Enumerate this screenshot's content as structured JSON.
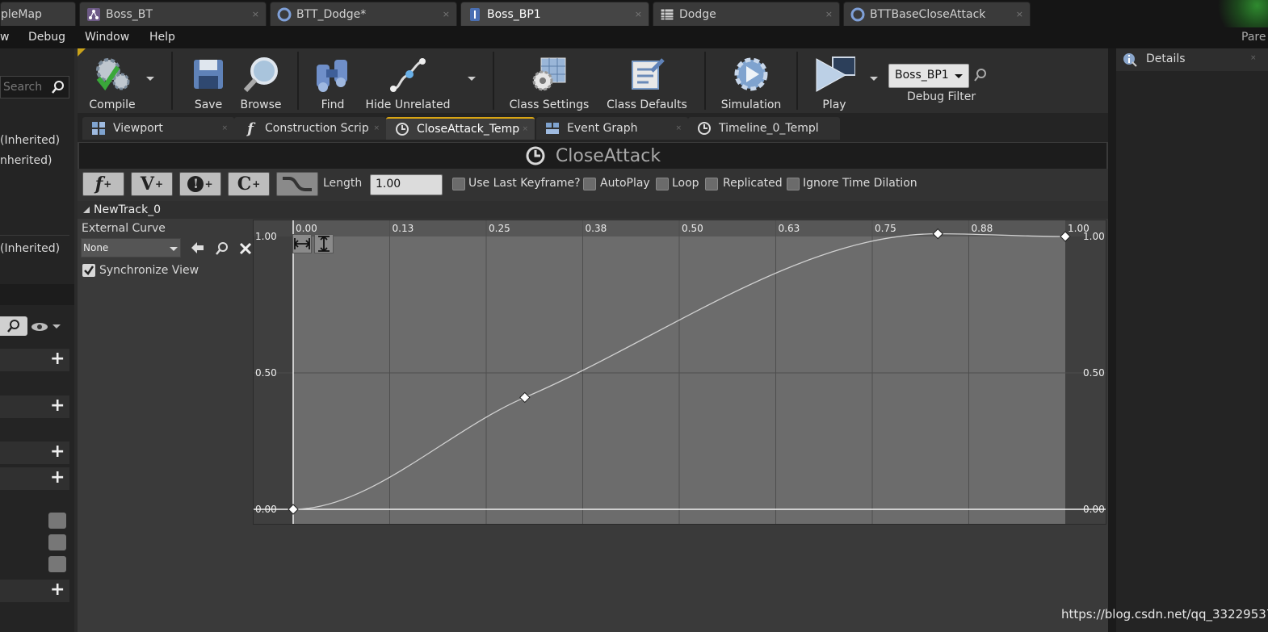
{
  "doc_tabs": [
    {
      "label": "pleMap",
      "icon": "map-icon",
      "active": false
    },
    {
      "label": "Boss_BT",
      "icon": "behavior-tree-icon",
      "active": false
    },
    {
      "label": "BTT_Dodge*",
      "icon": "blueprint-icon",
      "active": false
    },
    {
      "label": "Boss_BP1",
      "icon": "actor-blueprint-icon",
      "active": true
    },
    {
      "label": "Dodge",
      "icon": "datatable-icon",
      "active": false
    },
    {
      "label": "BTTBaseCloseAttack",
      "icon": "blueprint-icon",
      "active": false
    }
  ],
  "tab_close_glyph": "×",
  "top_right_label": "Pare",
  "menu": [
    "w",
    "Debug",
    "Window",
    "Help"
  ],
  "left_panel": {
    "search_placeholder": "Search",
    "inherited": [
      "(Inherited)",
      "nherited)",
      "(Inherited)"
    ]
  },
  "toolbar": {
    "compile": "Compile",
    "save": "Save",
    "browse": "Browse",
    "find": "Find",
    "hide_unrelated": "Hide Unrelated",
    "class_settings": "Class Settings",
    "class_defaults": "Class Defaults",
    "simulation": "Simulation",
    "play": "Play",
    "debug_filter_value": "Boss_BP1",
    "debug_filter_label": "Debug Filter"
  },
  "details_panel": {
    "title": "Details"
  },
  "editor_tabs": [
    {
      "label": "Viewport",
      "icon": "viewport-icon",
      "active": false
    },
    {
      "label": "Construction Scrip",
      "icon": "function-icon",
      "active": false
    },
    {
      "label": "CloseAttack_Temp",
      "icon": "timeline-icon",
      "active": true
    },
    {
      "label": "Event Graph",
      "icon": "event-graph-icon",
      "active": false
    },
    {
      "label": "Timeline_0_Templ",
      "icon": "timeline-icon",
      "active": false
    }
  ],
  "timeline": {
    "title": "CloseAttack",
    "track_buttons": [
      "f",
      "V",
      "!",
      "C"
    ],
    "length_label": "Length",
    "length_value": "1.00",
    "options": [
      {
        "label": "Use Last Keyframe?",
        "checked": false
      },
      {
        "label": "AutoPlay",
        "checked": false
      },
      {
        "label": "Loop",
        "checked": false
      },
      {
        "label": "Replicated",
        "checked": false
      },
      {
        "label": "Ignore Time Dilation",
        "checked": false
      }
    ],
    "track_name": "NewTrack_0",
    "external_curve_label": "External Curve",
    "external_curve_value": "None",
    "synchronize_view_label": "Synchronize View",
    "synchronize_view_checked": true
  },
  "chart_data": {
    "type": "line",
    "x_ticks": [
      "0.00",
      "0.13",
      "0.25",
      "0.38",
      "0.50",
      "0.63",
      "0.75",
      "0.88",
      "1.00"
    ],
    "y_ticks": [
      "1.00",
      "0.50",
      "0.00"
    ],
    "xlim": [
      0,
      1.0
    ],
    "ylim": [
      0,
      1.0
    ],
    "keys": [
      {
        "x": 0.0,
        "y": 0.0
      },
      {
        "x": 0.3,
        "y": 0.41
      },
      {
        "x": 0.835,
        "y": 1.01
      },
      {
        "x": 1.0,
        "y": 1.0
      }
    ]
  },
  "watermark": "https://blog.csdn.net/qq_33229537",
  "colors": {
    "active_tab_accent": "#d9a514",
    "curve": "#d0d0d0",
    "graph_bg": "#6c6c6c"
  }
}
